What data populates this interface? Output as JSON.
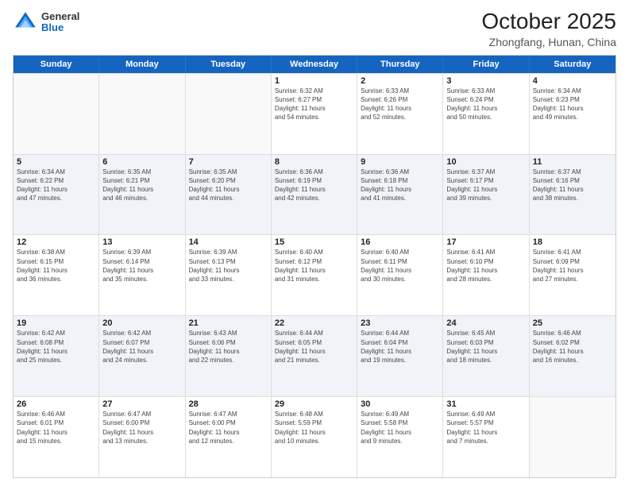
{
  "logo": {
    "general": "General",
    "blue": "Blue"
  },
  "title": {
    "month": "October 2025",
    "location": "Zhongfang, Hunan, China"
  },
  "dayHeaders": [
    "Sunday",
    "Monday",
    "Tuesday",
    "Wednesday",
    "Thursday",
    "Friday",
    "Saturday"
  ],
  "weeks": [
    [
      {
        "day": "",
        "info": "",
        "empty": true
      },
      {
        "day": "",
        "info": "",
        "empty": true
      },
      {
        "day": "",
        "info": "",
        "empty": true
      },
      {
        "day": "1",
        "info": "Sunrise: 6:32 AM\nSunset: 6:27 PM\nDaylight: 11 hours\nand 54 minutes."
      },
      {
        "day": "2",
        "info": "Sunrise: 6:33 AM\nSunset: 6:26 PM\nDaylight: 11 hours\nand 52 minutes."
      },
      {
        "day": "3",
        "info": "Sunrise: 6:33 AM\nSunset: 6:24 PM\nDaylight: 11 hours\nand 50 minutes."
      },
      {
        "day": "4",
        "info": "Sunrise: 6:34 AM\nSunset: 6:23 PM\nDaylight: 11 hours\nand 49 minutes."
      }
    ],
    [
      {
        "day": "5",
        "info": "Sunrise: 6:34 AM\nSunset: 6:22 PM\nDaylight: 11 hours\nand 47 minutes."
      },
      {
        "day": "6",
        "info": "Sunrise: 6:35 AM\nSunset: 6:21 PM\nDaylight: 11 hours\nand 46 minutes."
      },
      {
        "day": "7",
        "info": "Sunrise: 6:35 AM\nSunset: 6:20 PM\nDaylight: 11 hours\nand 44 minutes."
      },
      {
        "day": "8",
        "info": "Sunrise: 6:36 AM\nSunset: 6:19 PM\nDaylight: 11 hours\nand 42 minutes."
      },
      {
        "day": "9",
        "info": "Sunrise: 6:36 AM\nSunset: 6:18 PM\nDaylight: 11 hours\nand 41 minutes."
      },
      {
        "day": "10",
        "info": "Sunrise: 6:37 AM\nSunset: 6:17 PM\nDaylight: 11 hours\nand 39 minutes."
      },
      {
        "day": "11",
        "info": "Sunrise: 6:37 AM\nSunset: 6:16 PM\nDaylight: 11 hours\nand 38 minutes."
      }
    ],
    [
      {
        "day": "12",
        "info": "Sunrise: 6:38 AM\nSunset: 6:15 PM\nDaylight: 11 hours\nand 36 minutes."
      },
      {
        "day": "13",
        "info": "Sunrise: 6:39 AM\nSunset: 6:14 PM\nDaylight: 11 hours\nand 35 minutes."
      },
      {
        "day": "14",
        "info": "Sunrise: 6:39 AM\nSunset: 6:13 PM\nDaylight: 11 hours\nand 33 minutes."
      },
      {
        "day": "15",
        "info": "Sunrise: 6:40 AM\nSunset: 6:12 PM\nDaylight: 11 hours\nand 31 minutes."
      },
      {
        "day": "16",
        "info": "Sunrise: 6:40 AM\nSunset: 6:11 PM\nDaylight: 11 hours\nand 30 minutes."
      },
      {
        "day": "17",
        "info": "Sunrise: 6:41 AM\nSunset: 6:10 PM\nDaylight: 11 hours\nand 28 minutes."
      },
      {
        "day": "18",
        "info": "Sunrise: 6:41 AM\nSunset: 6:09 PM\nDaylight: 11 hours\nand 27 minutes."
      }
    ],
    [
      {
        "day": "19",
        "info": "Sunrise: 6:42 AM\nSunset: 6:08 PM\nDaylight: 11 hours\nand 25 minutes."
      },
      {
        "day": "20",
        "info": "Sunrise: 6:42 AM\nSunset: 6:07 PM\nDaylight: 11 hours\nand 24 minutes."
      },
      {
        "day": "21",
        "info": "Sunrise: 6:43 AM\nSunset: 6:06 PM\nDaylight: 11 hours\nand 22 minutes."
      },
      {
        "day": "22",
        "info": "Sunrise: 6:44 AM\nSunset: 6:05 PM\nDaylight: 11 hours\nand 21 minutes."
      },
      {
        "day": "23",
        "info": "Sunrise: 6:44 AM\nSunset: 6:04 PM\nDaylight: 11 hours\nand 19 minutes."
      },
      {
        "day": "24",
        "info": "Sunrise: 6:45 AM\nSunset: 6:03 PM\nDaylight: 11 hours\nand 18 minutes."
      },
      {
        "day": "25",
        "info": "Sunrise: 6:46 AM\nSunset: 6:02 PM\nDaylight: 11 hours\nand 16 minutes."
      }
    ],
    [
      {
        "day": "26",
        "info": "Sunrise: 6:46 AM\nSunset: 6:01 PM\nDaylight: 11 hours\nand 15 minutes."
      },
      {
        "day": "27",
        "info": "Sunrise: 6:47 AM\nSunset: 6:00 PM\nDaylight: 11 hours\nand 13 minutes."
      },
      {
        "day": "28",
        "info": "Sunrise: 6:47 AM\nSunset: 6:00 PM\nDaylight: 11 hours\nand 12 minutes."
      },
      {
        "day": "29",
        "info": "Sunrise: 6:48 AM\nSunset: 5:59 PM\nDaylight: 11 hours\nand 10 minutes."
      },
      {
        "day": "30",
        "info": "Sunrise: 6:49 AM\nSunset: 5:58 PM\nDaylight: 11 hours\nand 9 minutes."
      },
      {
        "day": "31",
        "info": "Sunrise: 6:49 AM\nSunset: 5:57 PM\nDaylight: 11 hours\nand 7 minutes."
      },
      {
        "day": "",
        "info": "",
        "empty": true
      }
    ]
  ]
}
